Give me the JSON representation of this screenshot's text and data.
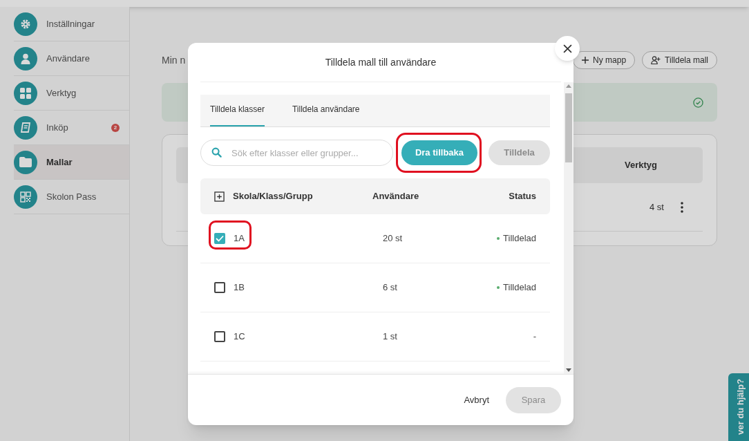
{
  "sidebar": {
    "items": [
      {
        "label": "Inställningar",
        "selected": false
      },
      {
        "label": "Användare",
        "selected": false
      },
      {
        "label": "Verktyg",
        "selected": false
      },
      {
        "label": "Inköp",
        "selected": false,
        "badge": "2"
      },
      {
        "label": "Mallar",
        "selected": true
      },
      {
        "label": "Skolon Pass",
        "selected": false
      }
    ]
  },
  "page": {
    "heading": "Min n",
    "buttons": [
      "Ny mapp",
      "Tilldela mall"
    ],
    "table_header": "Verktyg",
    "row_value": "4 st"
  },
  "help_tab": "ver du hjälp?",
  "dialog": {
    "title": "Tilldela mall till användare",
    "tabs": [
      {
        "label": "Tilldela klasser",
        "selected": true
      },
      {
        "label": "Tilldela användare",
        "selected": false
      }
    ],
    "search": {
      "placeholder": "Sök efter klasser eller grupper..."
    },
    "buttons": [
      {
        "label": "Dra tillbaka",
        "disabled": false
      },
      {
        "label": "Tilldela",
        "disabled": true
      }
    ],
    "columns": [
      "Skola/Klass/Grupp",
      "Användare",
      "Status"
    ],
    "rows": [
      {
        "name": "1A",
        "users": "20 st",
        "status": "Tilldelad",
        "assigned": true,
        "checked": true
      },
      {
        "name": "1B",
        "users": "6 st",
        "status": "Tilldelad",
        "assigned": true,
        "checked": false
      },
      {
        "name": "1C",
        "users": "1 st",
        "status": "-",
        "assigned": false,
        "checked": false
      }
    ],
    "footer": {
      "cancel": "Avbryt",
      "save": {
        "label": "Spara",
        "disabled": true
      }
    }
  }
}
